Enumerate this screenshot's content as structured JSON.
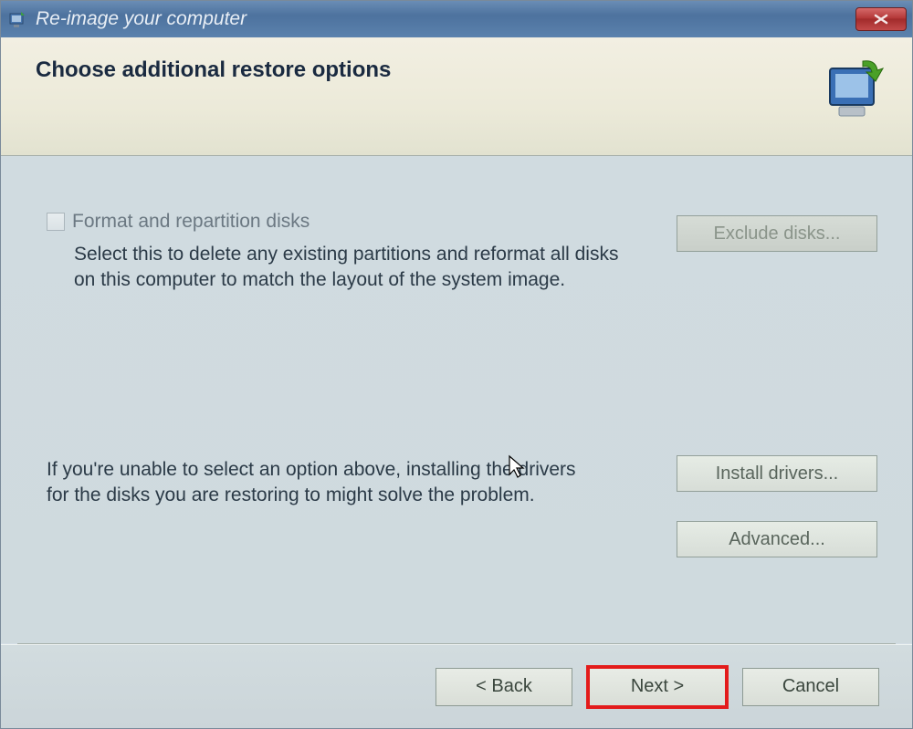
{
  "window": {
    "title": "Re-image your computer"
  },
  "header": {
    "title": "Choose additional restore options"
  },
  "option": {
    "checkbox_label": "Format and repartition disks",
    "description": "Select this to delete any existing partitions and reformat all disks on this computer to match the layout of the system image."
  },
  "buttons": {
    "exclude": "Exclude disks...",
    "install_drivers": "Install drivers...",
    "advanced": "Advanced..."
  },
  "hint": "If you're unable to select an option above, installing the drivers for the disks you are restoring to might solve the problem.",
  "footer": {
    "back": "< Back",
    "next": "Next >",
    "cancel": "Cancel"
  }
}
